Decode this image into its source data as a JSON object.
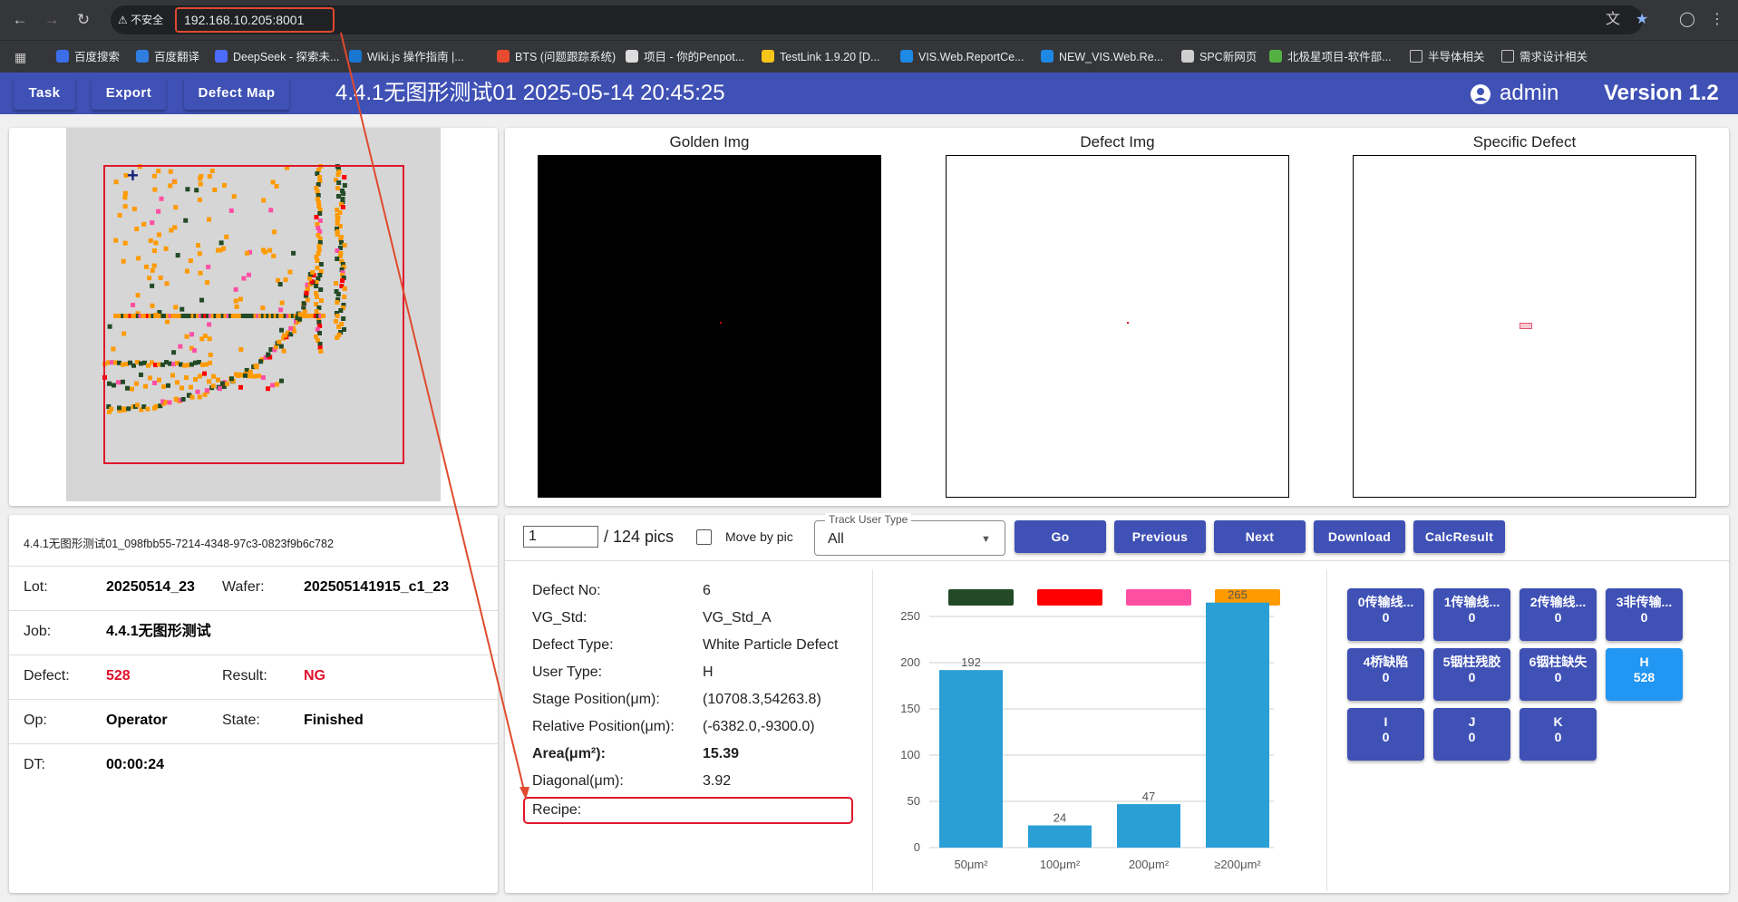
{
  "browser": {
    "insecure_label": "不安全",
    "url": "192.168.10.205:8001",
    "bookmarks": [
      {
        "label": "百度搜索",
        "color": "#3b6ee8"
      },
      {
        "label": "百度翻译",
        "color": "#2f7de1"
      },
      {
        "label": "DeepSeek - 探索未...",
        "color": "#4d6bfe"
      },
      {
        "label": "Wiki.js 操作指南 |...",
        "color": "#1976d2"
      },
      {
        "label": "BTS (问题跟踪系统)",
        "color": "#e84a2f"
      },
      {
        "label": "项目 - 你的Penpot...",
        "color": "#dddddd"
      },
      {
        "label": "TestLink 1.9.20 [D...",
        "color": "#f5c518"
      },
      {
        "label": "VIS.Web.ReportCe...",
        "color": "#1e88e5"
      },
      {
        "label": "NEW_VIS.Web.Re...",
        "color": "#1e88e5"
      },
      {
        "label": "SPC新网页",
        "color": "#cfcfcf"
      },
      {
        "label": "北极星项目-软件部...",
        "color": "#55b043"
      },
      {
        "label": "半导体相关",
        "color": "#35363a"
      },
      {
        "label": "需求设计相关",
        "color": "#35363a"
      }
    ]
  },
  "header": {
    "task_label": "Task",
    "export_label": "Export",
    "defect_map_label": "Defect Map",
    "title": "4.4.1无图形测试01   2025-05-14 20:45:25",
    "user": "admin",
    "version": "Version 1.2"
  },
  "images": {
    "golden": "Golden Img",
    "defect": "Defect Img",
    "specific": "Specific Defect"
  },
  "info": {
    "filename": "4.4.1无图形测试01_098fbb55-7214-4348-97c3-0823f9b6c782",
    "lot_label": "Lot:",
    "lot": "20250514_23",
    "wafer_label": "Wafer:",
    "wafer": "202505141915_c1_23",
    "job_label": "Job:",
    "job": "4.4.1无图形测试",
    "defect_label": "Defect:",
    "defect": "528",
    "result_label": "Result:",
    "result": "NG",
    "op_label": "Op:",
    "op": "Operator",
    "state_label": "State:",
    "state": "Finished",
    "dt_label": "DT:",
    "dt": "00:00:24"
  },
  "controls": {
    "pic_value": "1",
    "pic_total": "/ 124 pics",
    "move_by_pic": "Move by pic",
    "track_legend": "Track User Type",
    "track_value": "All",
    "go": "Go",
    "previous": "Previous",
    "next": "Next",
    "download": "Download",
    "calc": "CalcResult"
  },
  "detail": {
    "defect_no_label": "Defect No:",
    "defect_no": "6",
    "vg_std_label": "VG_Std:",
    "vg_std": "VG_Std_A",
    "defect_type_label": "Defect Type:",
    "defect_type": "White Particle Defect",
    "user_type_label": "User Type:",
    "user_type": "H",
    "stage_label": "Stage Position(μm):",
    "stage": "(10708.3,54263.8)",
    "relative_label": "Relative Position(μm):",
    "relative": "(-6382.0,-9300.0)",
    "area_label": "Area(μm²):",
    "area": "15.39",
    "diagonal_label": "Diagonal(μm):",
    "diagonal": "3.92",
    "recipe_label": "Recipe:"
  },
  "chart_data": {
    "type": "bar",
    "categories": [
      "50μm²",
      "100μm²",
      "200μm²",
      "≥200μm²"
    ],
    "values": [
      192,
      24,
      47,
      265
    ],
    "ylim": [
      0,
      250
    ],
    "yticks": [
      0,
      50,
      100,
      150,
      200,
      250
    ],
    "bar_color": "#2a9fd6",
    "legend_colors": [
      "#234a26",
      "#ff0000",
      "#ff4fa3",
      "#ff9a00"
    ],
    "grid": true
  },
  "tiles": [
    {
      "label": "0传输线...",
      "value": "0"
    },
    {
      "label": "1传输线...",
      "value": "0"
    },
    {
      "label": "2传输线...",
      "value": "0"
    },
    {
      "label": "3非传输...",
      "value": "0"
    },
    {
      "label": "4桥缺陷",
      "value": "0"
    },
    {
      "label": "5铟柱残胶",
      "value": "0"
    },
    {
      "label": "6铟柱缺失",
      "value": "0"
    },
    {
      "label": "H",
      "value": "528",
      "active": true
    },
    {
      "label": "I",
      "value": "0"
    },
    {
      "label": "J",
      "value": "0"
    },
    {
      "label": "K",
      "value": "0"
    }
  ]
}
